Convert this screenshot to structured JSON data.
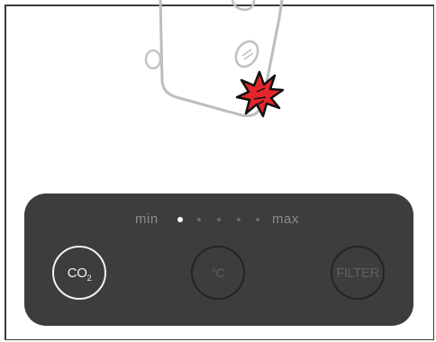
{
  "level_indicator": {
    "min_label": "min",
    "max_label": "max",
    "total_steps": 5,
    "current_step": 1
  },
  "buttons": {
    "co2": {
      "main": "CO",
      "sub": "2",
      "active": true
    },
    "temperature": {
      "label": "°C",
      "active": false
    },
    "filter": {
      "label": "FILTER",
      "active": false
    }
  },
  "illustration": {
    "alert_icon": "red-splat-icon",
    "alert_color": "#e3262b"
  },
  "colors": {
    "panel": "#3b3d3e",
    "active": "#f2f2f2",
    "inactive": "#5e6061"
  }
}
